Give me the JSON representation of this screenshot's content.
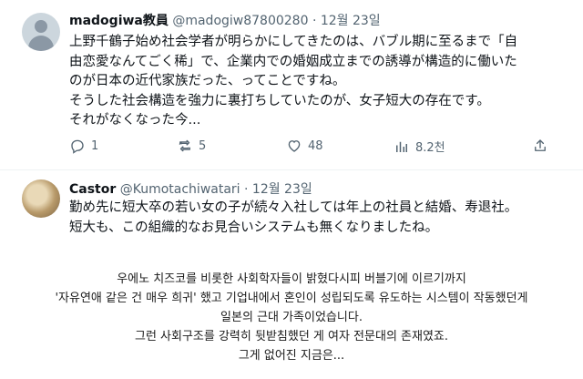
{
  "tweet1": {
    "display_name": "madogiwa教員",
    "handle_date": "@madogiw87800280 · 12월 23일",
    "lines": [
      "上野千鶴子始め社会学者が明らかにしてきたのは、バブル期に至るまで「自",
      "由恋愛なんてごく稀」で、企業内での婚姻成立までの誘導が構造的に働いた",
      "のが日本の近代家族だった、ってことですね。",
      "そうした社会構造を強力に裏打ちしていたのが、女子短大の存在です。",
      "それがなくなった今..."
    ],
    "replies": "1",
    "retweets": "5",
    "likes": "48",
    "views": "8.2천",
    "icons": [
      "reply-icon",
      "retweet-icon",
      "like-icon",
      "views-icon",
      "share-icon"
    ]
  },
  "tweet2": {
    "display_name": "Castor",
    "handle_date": "@Kumotachiwatari · 12월 23일",
    "lines": [
      "勤め先に短大卒の若い女の子が続々入社しては年上の社員と結婚、寿退社。",
      "短大も、この組織的なお見合いシステムも無くなりましたね。"
    ]
  },
  "translation": {
    "lines": [
      "우에노 치즈코를 비롯한 사회학자들이 밝혔다시피 버블기에 이르기까지",
      "'자유연애 같은 건 매우 희귀' 했고 기업내에서 혼인이 성립되도록 유도하는 시스템이 작동했던게",
      "일본의 근대 가족이었습니다.",
      "그런 사회구조를 강력히 뒷받침했던 게 여자 전문대의 존재였죠.",
      "그게 없어진 지금은..."
    ]
  },
  "colors": {
    "text": "#0f1419",
    "secondary": "#536471",
    "divider": "#eff3f4"
  }
}
